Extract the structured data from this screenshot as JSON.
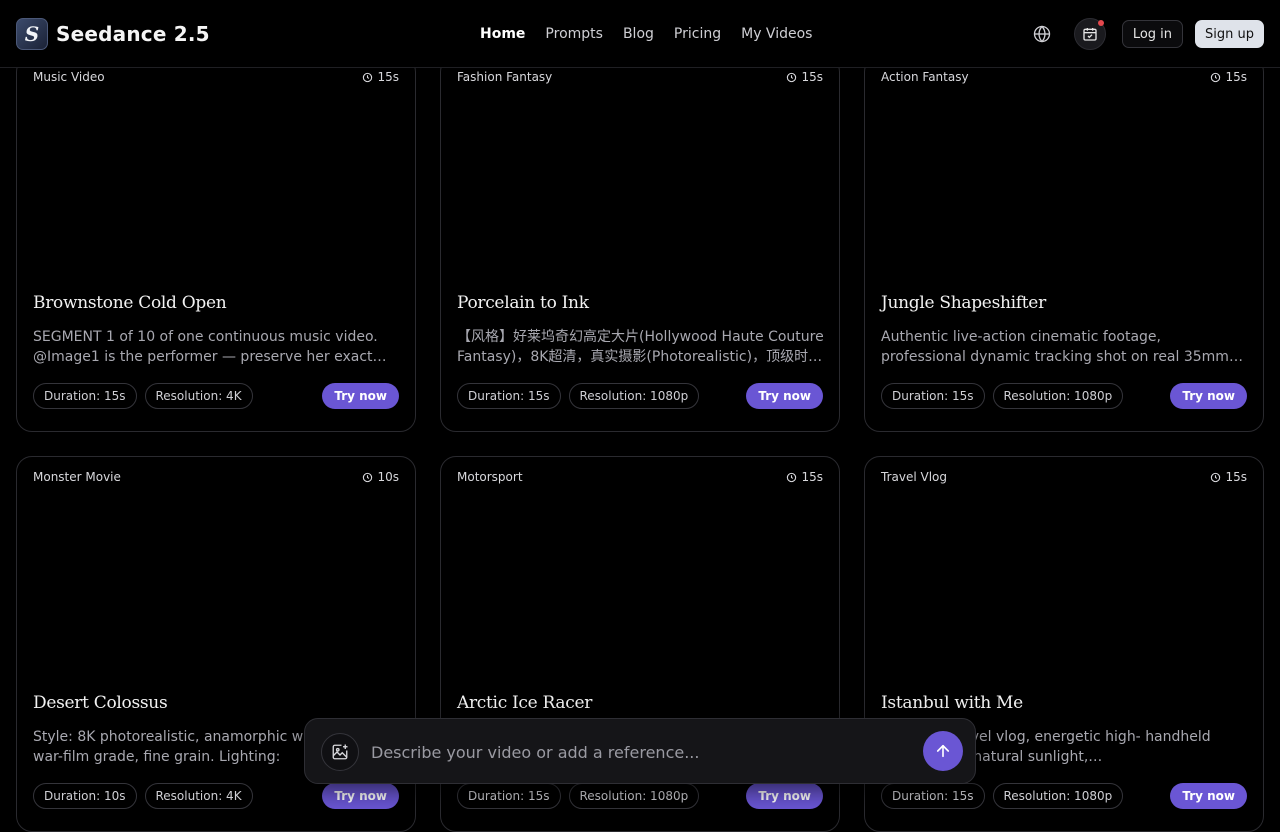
{
  "brand": {
    "logo_letter": "S",
    "name": "Seedance 2.5"
  },
  "nav": {
    "items": [
      {
        "label": "Home",
        "active": true
      },
      {
        "label": "Prompts",
        "active": false
      },
      {
        "label": "Blog",
        "active": false
      },
      {
        "label": "Pricing",
        "active": false
      },
      {
        "label": "My Videos",
        "active": false
      }
    ]
  },
  "header_actions": {
    "login_label": "Log in",
    "signup_label": "Sign up",
    "icons": [
      "globe-icon",
      "calendar-icon"
    ]
  },
  "cards": [
    {
      "category": "Music Video",
      "duration": "15s",
      "title": "Brownstone Cold Open",
      "description": "SEGMENT 1 of 10 of one continuous music video. @Image1 is the performer — preserve her exact…",
      "duration_chip": "Duration: 15s",
      "resolution_chip": "Resolution: 4K",
      "cta": "Try now"
    },
    {
      "category": "Fashion Fantasy",
      "duration": "15s",
      "title": "Porcelain to Ink",
      "description": "【风格】好莱坞奇幻高定大片(Hollywood Haute Couture Fantasy)，8K超清，真实摄影(Photorealistic)，顶级时…",
      "duration_chip": "Duration: 15s",
      "resolution_chip": "Resolution: 1080p",
      "cta": "Try now"
    },
    {
      "category": "Action Fantasy",
      "duration": "15s",
      "title": "Jungle Shapeshifter",
      "description": "Authentic live-action cinematic footage, professional dynamic tracking shot on real 35mm film with Arri…",
      "duration_chip": "Duration: 15s",
      "resolution_chip": "Resolution: 1080p",
      "cta": "Try now"
    },
    {
      "category": "Monster Movie",
      "duration": "10s",
      "title": "Desert Colossus",
      "description": "Style: 8K photorealistic, anamorphic wide gritty war-film grade, fine grain. Lighting:",
      "duration_chip": "Duration: 10s",
      "resolution_chip": "Resolution: 4K",
      "cta": "Try now"
    },
    {
      "category": "Motorsport",
      "duration": "15s",
      "title": "Arctic Ice Racer",
      "description": "",
      "duration_chip": "Duration: 15s",
      "resolution_chip": "Resolution: 1080p",
      "cta": "Try now"
    },
    {
      "category": "Travel Vlog",
      "duration": "15s",
      "title": "Istanbul with Me",
      "description": "tic luxury travel vlog, energetic high- handheld camera feel, natural sunlight,…",
      "duration_chip": "Duration: 15s",
      "resolution_chip": "Resolution: 1080p",
      "cta": "Try now"
    }
  ],
  "prompt": {
    "placeholder": "Describe your video or add a reference...",
    "value": "",
    "icons": [
      "add-image-icon",
      "arrow-up-icon"
    ]
  },
  "colors": {
    "background": "#000000",
    "accent": "#6a56d4",
    "notification": "#e5484d",
    "signup_bg": "#dfe3ea"
  }
}
